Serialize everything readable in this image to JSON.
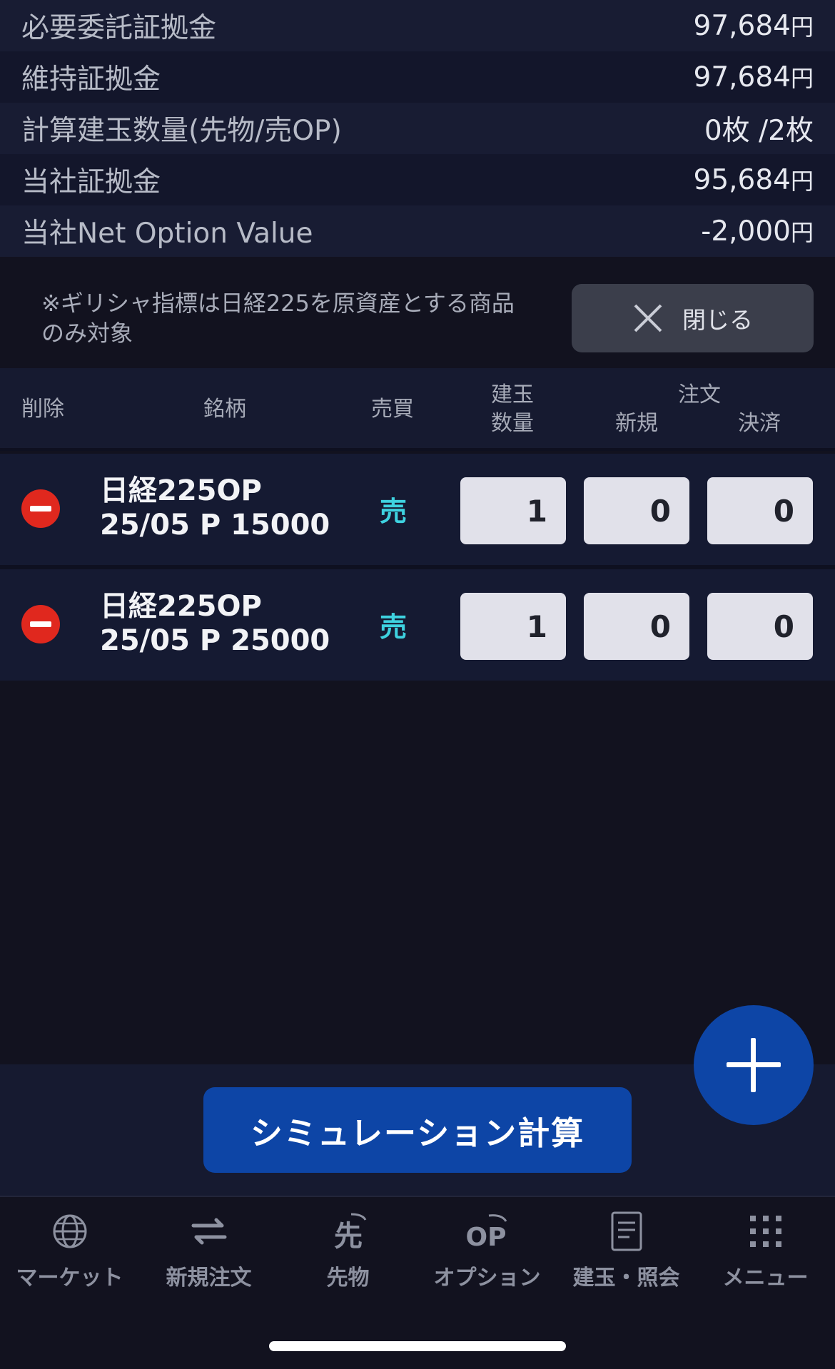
{
  "summary": [
    {
      "label": "必要委託証拠金",
      "value": "97,684",
      "unit": "円"
    },
    {
      "label": "維持証拠金",
      "value": "97,684",
      "unit": "円"
    },
    {
      "label": "計算建玉数量(先物/売OP)",
      "value": "0枚 /2枚",
      "unit": ""
    },
    {
      "label": "当社証拠金",
      "value": "95,684",
      "unit": "円"
    },
    {
      "label": "当社Net Option Value",
      "value": "-2,000",
      "unit": "円"
    }
  ],
  "note": {
    "line1": "※ギリシャ指標は日経225を原資産とする商品",
    "line2": "のみ対象",
    "close_label": "閉じる"
  },
  "table_header": {
    "delete": "削除",
    "symbol": "銘柄",
    "side": "売買",
    "position_qty_1": "建玉",
    "position_qty_2": "数量",
    "order": "注文",
    "new": "新規",
    "settle": "決済"
  },
  "rows": [
    {
      "name_line1": "日経225OP",
      "name_line2": "25/05 P 15000",
      "side": "売",
      "position_qty": "1",
      "new_qty": "0",
      "settle_qty": "0"
    },
    {
      "name_line1": "日経225OP",
      "name_line2": "25/05 P 25000",
      "side": "売",
      "position_qty": "1",
      "new_qty": "0",
      "settle_qty": "0"
    }
  ],
  "simulate_label": "シミュレーション計算",
  "tabs": [
    {
      "label": "マーケット",
      "icon": "globe-icon"
    },
    {
      "label": "新規注文",
      "icon": "swap-arrows-icon"
    },
    {
      "label": "先物",
      "icon": "futures-icon"
    },
    {
      "label": "オプション",
      "icon": "option-op-icon"
    },
    {
      "label": "建玉・照会",
      "icon": "document-icon"
    },
    {
      "label": "メニュー",
      "icon": "grid-menu-icon"
    }
  ],
  "colors": {
    "accent_blue": "#0d45a6",
    "sell_cyan": "#3ed2e0",
    "delete_red": "#e0281e"
  }
}
